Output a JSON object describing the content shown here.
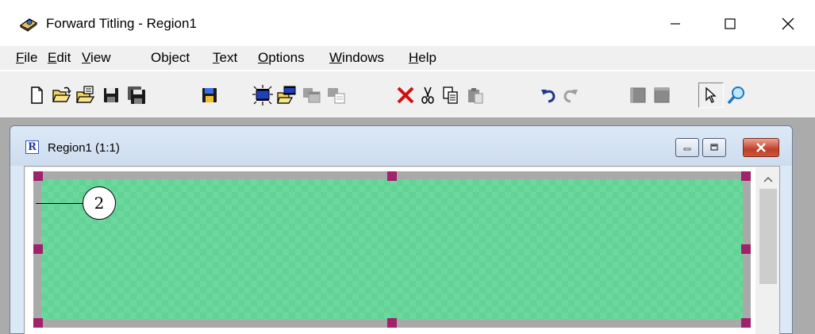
{
  "app": {
    "title": "Forward Titling - Region1",
    "window_controls": [
      "minimize-icon",
      "maximize-icon",
      "close-icon"
    ]
  },
  "menu": [
    {
      "mnemonic": "F",
      "rest": "ile"
    },
    {
      "mnemonic": "E",
      "rest": "dit"
    },
    {
      "mnemonic": "V",
      "rest": "iew"
    },
    {
      "mnemonic": "",
      "rest": "Object"
    },
    {
      "mnemonic": "T",
      "rest": "ext"
    },
    {
      "mnemonic": "O",
      "rest": "ptions"
    },
    {
      "mnemonic": "W",
      "rest": "indows"
    },
    {
      "mnemonic": "H",
      "rest": "elp"
    }
  ],
  "toolbar": {
    "buttons": [
      "new-icon",
      "open-icon",
      "open-template-icon",
      "save-icon",
      "save-all-icon",
      "save-region-icon",
      "import-clip-icon",
      "open-clip-icon",
      "copy-clip-icon",
      "paste-clip-icon",
      "delete-icon",
      "cut-icon",
      "copy-icon",
      "paste-icon",
      "undo-icon",
      "redo-icon",
      "object-front-icon",
      "object-back-icon",
      "select-pointer-icon",
      "zoom-icon"
    ],
    "disabled": [
      "copy-clip-icon",
      "paste-clip-icon",
      "paste-icon",
      "redo-icon",
      "object-front-icon",
      "object-back-icon"
    ],
    "pressed": [
      "select-pointer-icon"
    ]
  },
  "child_window": {
    "icon_letter": "R",
    "title": "Region1  (1:1)",
    "controls": [
      "minimize-icon",
      "restore-icon",
      "close-icon"
    ]
  },
  "canvas": {
    "callout_label": "2",
    "colors": {
      "fill": "#62d295",
      "frame": "#a9a9a9",
      "handle": "#a0226a"
    }
  }
}
